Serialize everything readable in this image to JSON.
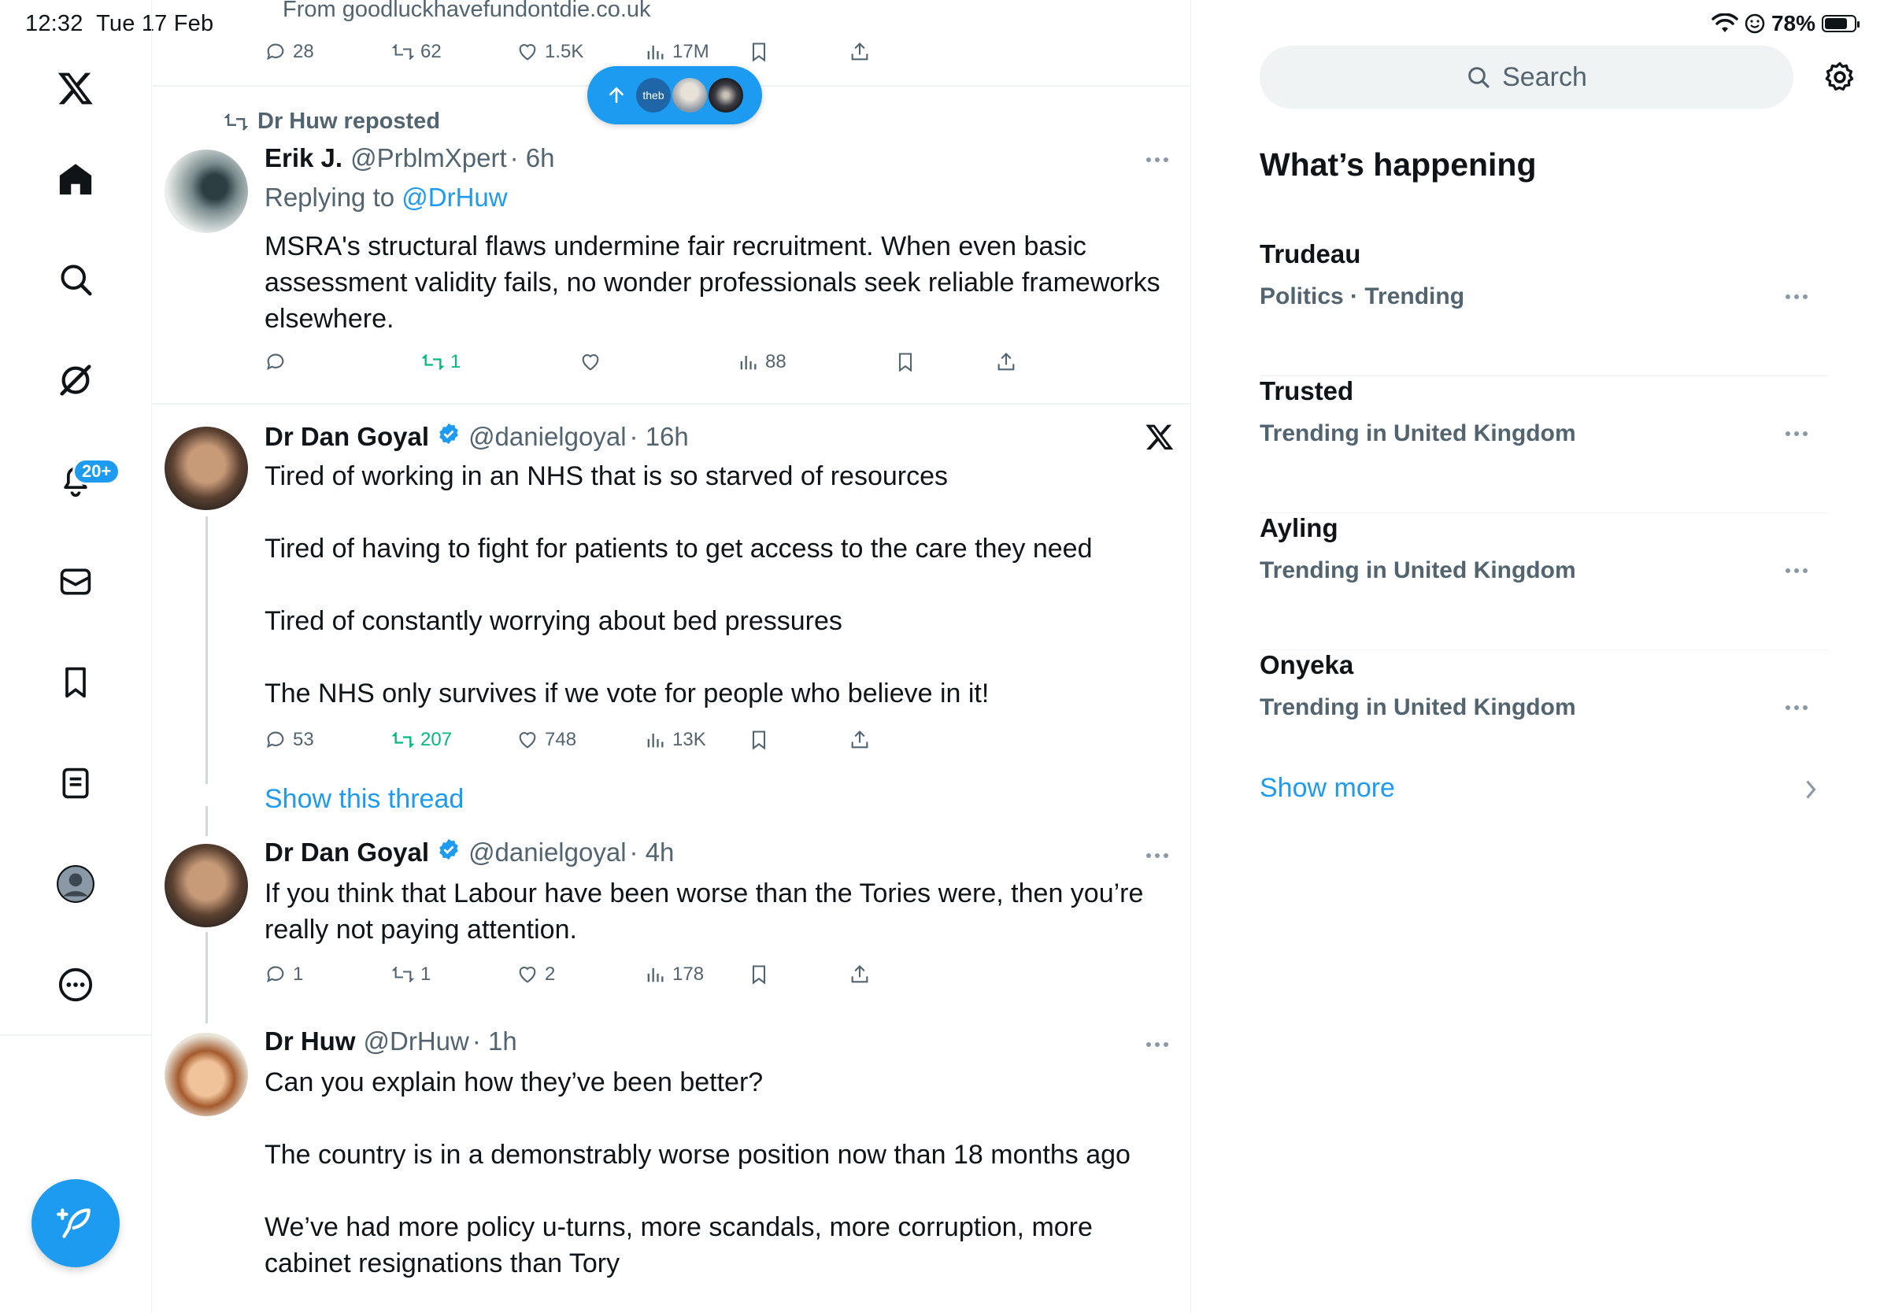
{
  "status_bar": {
    "time": "12:32",
    "date": "Tue 17 Feb",
    "battery": "78%",
    "battery_level": 0.78
  },
  "rail": {
    "items": [
      "x-logo",
      "home",
      "explore",
      "grok",
      "notifications",
      "messages",
      "bookmarks",
      "lists",
      "profile",
      "more"
    ],
    "notifications_badge": "20+"
  },
  "top_tweet": {
    "source": "From goodluckhavefundontdie.co.uk",
    "stats": {
      "replies": "28",
      "reposts": "62",
      "likes": "1.5K",
      "views": "17M"
    }
  },
  "tweets": [
    {
      "reposted_by": "Dr Huw reposted",
      "name": "Erik J.",
      "handle": "@PrblmXpert",
      "time": "· 6h",
      "replying_prefix": "Replying to",
      "replying_to": "@DrHuw",
      "text": "MSRA's structural flaws undermine fair recruitment. When even basic assessment validity fails, no wonder professionals seek reliable frameworks elsewhere.",
      "stats": {
        "replies": "",
        "reposts": "1",
        "likes": "",
        "views": "88"
      }
    },
    {
      "name": "Dr Dan Goyal",
      "handle": "@danielgoyal",
      "time": "· 16h",
      "text": "Tired of working in an NHS that is so starved of resources\n\nTired of having to fight for patients to get access to the care they need\n\nTired of constantly worrying about bed pressures\n\nThe NHS only survives if we vote for people who believe in it!",
      "stats": {
        "replies": "53",
        "reposts": "207",
        "likes": "748",
        "views": "13K"
      },
      "show_thread": "Show this thread"
    },
    {
      "name": "Dr Dan Goyal",
      "handle": "@danielgoyal",
      "time": "· 4h",
      "text": "If you think that Labour have been worse than the Tories were, then you’re really not paying attention.",
      "stats": {
        "replies": "1",
        "reposts": "1",
        "likes": "2",
        "views": "178"
      }
    },
    {
      "name": "Dr Huw",
      "handle": "@DrHuw",
      "time": "· 1h",
      "text": "Can you explain how they’ve been better?\n\nThe country is in a demonstrably worse position now than 18 months ago\n\nWe’ve had more policy u-turns, more scandals, more corruption, more cabinet resignations than Tory"
    }
  ],
  "new_posts_pill": {
    "label": "theb"
  },
  "right": {
    "search_placeholder": "Search",
    "section_title": "What’s happening",
    "trends": [
      {
        "name": "Trudeau",
        "context": "Politics · Trending"
      },
      {
        "name": "Trusted",
        "context": "Trending in United Kingdom"
      },
      {
        "name": "Ayling",
        "context": "Trending in United Kingdom"
      },
      {
        "name": "Onyeka",
        "context": "Trending in United Kingdom"
      }
    ],
    "show_more": "Show more"
  },
  "colors": {
    "accent": "#1d9bf0",
    "repost_green": "#00ba7c",
    "muted": "#536471"
  }
}
